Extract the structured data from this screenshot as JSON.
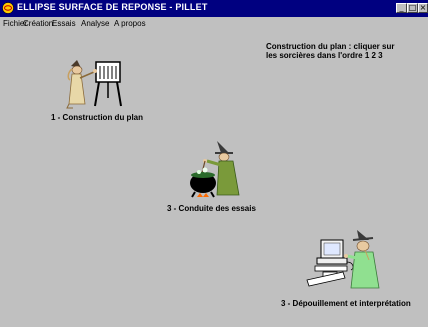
{
  "window": {
    "title": "ELLIPSE SURFACE DE REPONSE - PILLET",
    "controls": {
      "minimize": "_",
      "maximize": "□",
      "close": "×"
    }
  },
  "menu": [
    "Fichier",
    "Création",
    "Essais",
    "Analyse",
    "A propos"
  ],
  "instructions": {
    "line1": "Construction du plan : cliquer sur",
    "line2": "les sorcières dans l'ordre  1 2 3"
  },
  "steps": [
    {
      "label": "1 - Construction du plan",
      "icon": "witch-board-icon"
    },
    {
      "label": "3 - Conduite des essais",
      "icon": "witch-cauldron-icon"
    },
    {
      "label": "3 - Dépouillement et interprétation",
      "icon": "witch-computer-icon"
    }
  ],
  "colors": {
    "titlebar": "#000080",
    "window_bg": "#c0c0c0",
    "witch_robe": "#90e090",
    "cauldron": "#000000"
  }
}
